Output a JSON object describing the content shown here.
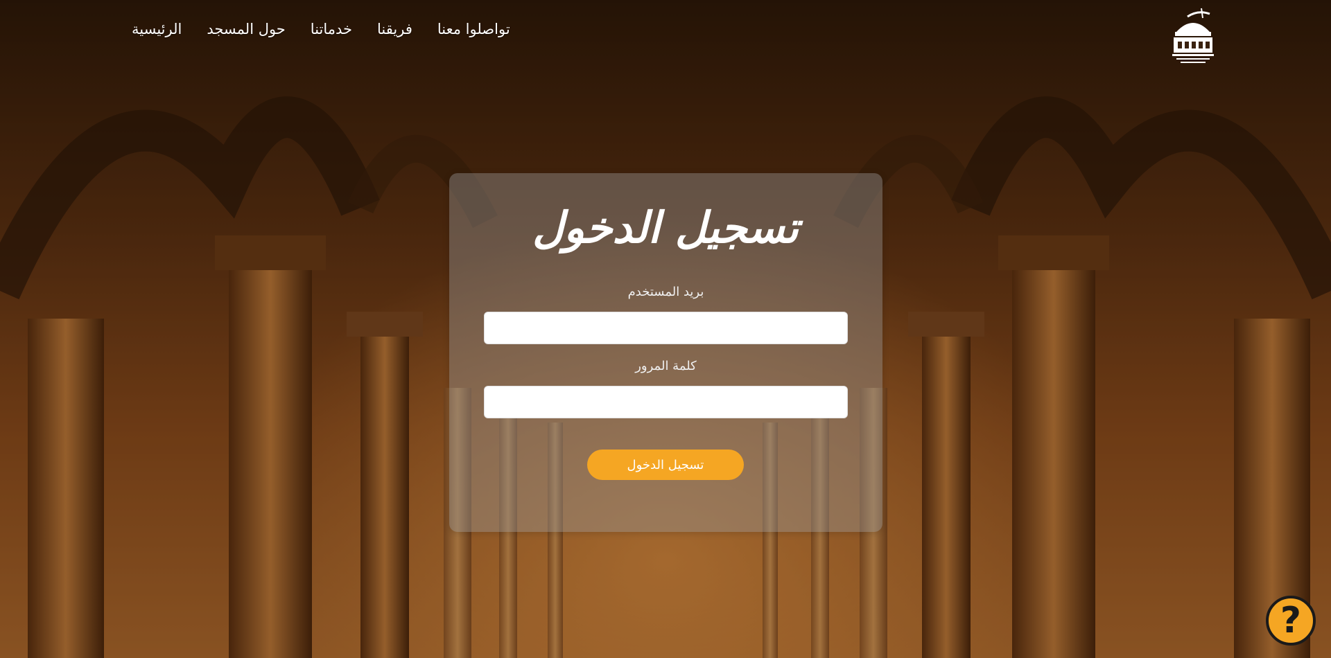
{
  "nav": {
    "items": [
      {
        "label": "الرئيسية"
      },
      {
        "label": "حول المسجد"
      },
      {
        "label": "خدماتنا"
      },
      {
        "label": "فريقنا"
      },
      {
        "label": "تواصلوا معنا"
      }
    ]
  },
  "login": {
    "title": "تسجيل الدخول",
    "email_label": "بريد المستخدم",
    "email_value": "",
    "password_label": "كلمة المرور",
    "password_value": "",
    "submit_label": "تسجيل الدخول"
  },
  "help": {
    "icon": "question-mark-icon",
    "symbol": "?"
  },
  "colors": {
    "accent": "#f5a623",
    "card_bg": "rgba(150,150,150,0.42)",
    "text": "#ffffff"
  }
}
